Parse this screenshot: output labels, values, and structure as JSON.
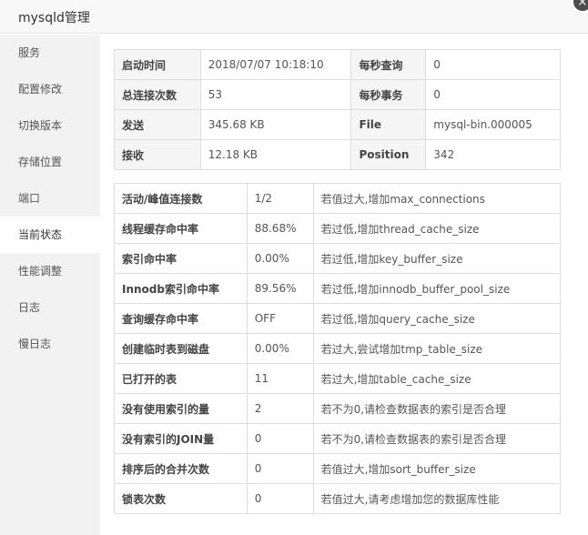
{
  "window": {
    "title": "mysqld管理",
    "close_glyph": "×"
  },
  "sidebar": {
    "items": [
      {
        "label": "服务",
        "active": false
      },
      {
        "label": "配置修改",
        "active": false
      },
      {
        "label": "切换版本",
        "active": false
      },
      {
        "label": "存储位置",
        "active": false
      },
      {
        "label": "端口",
        "active": false
      },
      {
        "label": "当前状态",
        "active": true
      },
      {
        "label": "性能调整",
        "active": false
      },
      {
        "label": "日志",
        "active": false
      },
      {
        "label": "慢日志",
        "active": false
      }
    ]
  },
  "summary": {
    "rows": [
      [
        "启动时间",
        "2018/07/07 10:18:10",
        "每秒查询",
        "0"
      ],
      [
        "总连接次数",
        "53",
        "每秒事务",
        "0"
      ],
      [
        "发送",
        "345.68 KB",
        "File",
        "mysql-bin.000005"
      ],
      [
        "接收",
        "12.18 KB",
        "Position",
        "342"
      ]
    ]
  },
  "metrics": {
    "rows": [
      [
        "活动/峰值连接数",
        "1/2",
        "若值过大,增加max_connections"
      ],
      [
        "线程缓存命中率",
        "88.68%",
        "若过低,增加thread_cache_size"
      ],
      [
        "索引命中率",
        "0.00%",
        "若过低,增加key_buffer_size"
      ],
      [
        "Innodb索引命中率",
        "89.56%",
        "若过低,增加innodb_buffer_pool_size"
      ],
      [
        "查询缓存命中率",
        "OFF",
        "若过低,增加query_cache_size"
      ],
      [
        "创建临时表到磁盘",
        "0.00%",
        "若过大,尝试增加tmp_table_size"
      ],
      [
        "已打开的表",
        "11",
        "若过大,增加table_cache_size"
      ],
      [
        "没有使用索引的量",
        "2",
        "若不为0,请检查数据表的索引是否合理"
      ],
      [
        "没有索引的JOIN量",
        "0",
        "若不为0,请检查数据表的索引是否合理"
      ],
      [
        "排序后的合并次数",
        "0",
        "若值过大,增加sort_buffer_size"
      ],
      [
        "锁表次数",
        "0",
        "若值过大,请考虑增加您的数据库性能"
      ]
    ]
  }
}
